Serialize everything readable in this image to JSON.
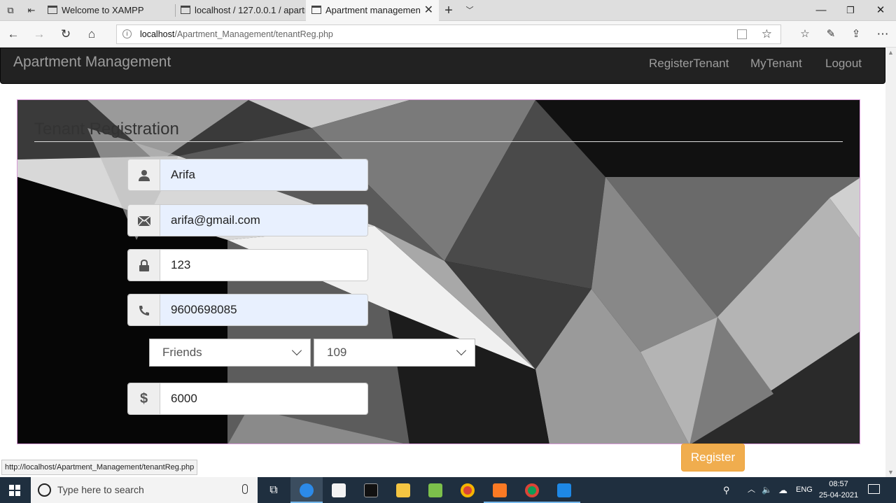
{
  "browser": {
    "tabs": [
      {
        "title": "Welcome to XAMPP"
      },
      {
        "title": "localhost / 127.0.0.1 / apartr"
      },
      {
        "title": "Apartment managemen"
      }
    ],
    "url_host": "localhost",
    "url_path": "/Apartment_Management/tenantReg.php",
    "status_url": "http://localhost/Apartment_Management/tenantReg.php"
  },
  "navbar": {
    "brand": "Apartment Management",
    "links": [
      "RegisterTenant",
      "MyTenant",
      "Logout"
    ]
  },
  "form": {
    "title": "Tenant Registration",
    "name_value": "Arifa",
    "email_value": "arifa@gmail.com",
    "password_value": "123",
    "phone_value": "9600698085",
    "relation_select": "Friends",
    "room_select": "109",
    "rent_value": "6000",
    "rent_addon": "$",
    "submit_label": "Register"
  },
  "taskbar": {
    "search_placeholder": "Type here to search",
    "language": "ENG",
    "time": "08:57",
    "date": "25-04-2021"
  },
  "colors": {
    "navbar": "#222222",
    "register_button": "#f0ad4e",
    "panel_border": "#d99ad9",
    "autofill": "#e8f0fe"
  }
}
